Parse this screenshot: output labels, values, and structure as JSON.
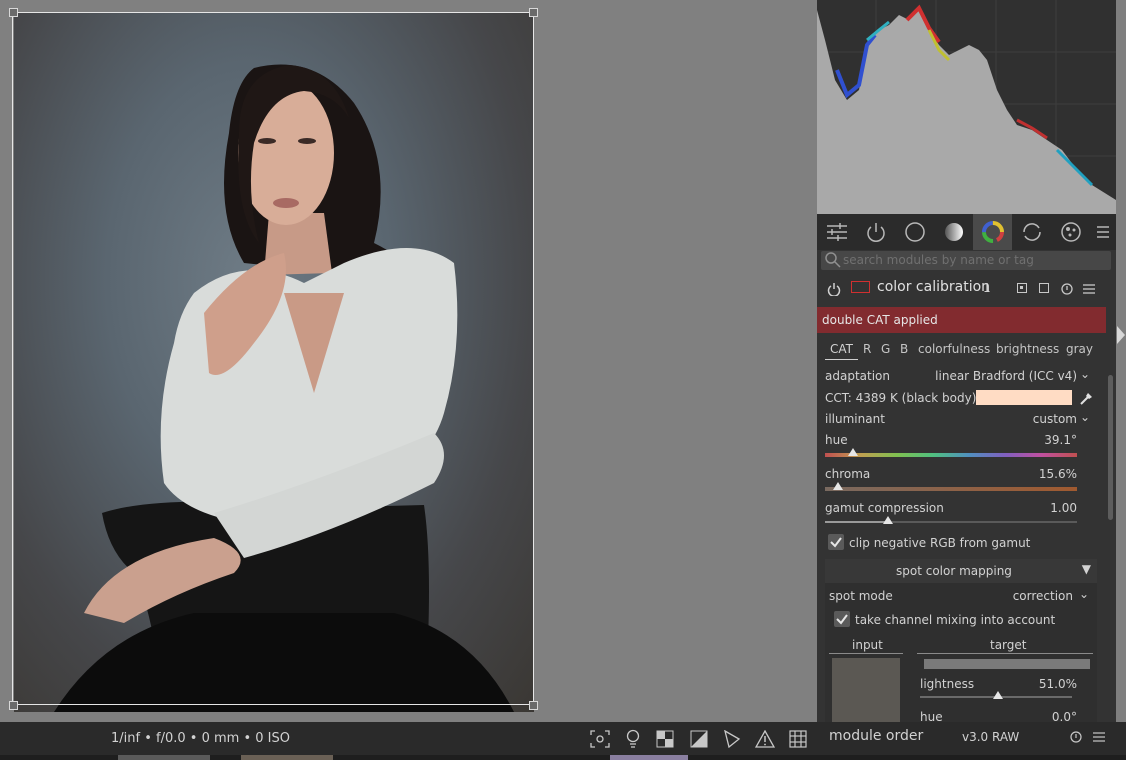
{
  "photo_info": "1/inf • f/0.0 • 0 mm • 0 ISO",
  "search": {
    "placeholder": "search modules by name or tag"
  },
  "module": {
    "name": "color calibration",
    "instance": "1",
    "warning": "double CAT applied",
    "tabs": [
      "CAT",
      "R",
      "G",
      "B",
      "colorfulness",
      "brightness",
      "gray"
    ],
    "active_tab": "CAT",
    "adaptation_label": "adaptation",
    "adaptation_value": "linear Bradford (ICC v4)",
    "cct_label": "CCT: 4389 K (black body)",
    "cct_swatch_color": "#ffdcc4",
    "illuminant_label": "illuminant",
    "illuminant_value": "custom",
    "hue_label": "hue",
    "hue_value": "39.1°",
    "hue_fraction": 0.11,
    "chroma_label": "chroma",
    "chroma_value": "15.6%",
    "chroma_fraction": 0.05,
    "gamut_label": "gamut compression",
    "gamut_value": "1.00",
    "gamut_fraction": 0.25,
    "clip_label": "clip negative RGB from gamut",
    "clip_checked": true,
    "spot_section": "spot color mapping",
    "spot_mode_label": "spot mode",
    "spot_mode_value": "correction",
    "channel_mixing_label": "take channel mixing into account",
    "channel_mixing_checked": true,
    "input_label": "input",
    "target_label": "target",
    "lightness_label": "lightness",
    "lightness_value": "51.0%",
    "lightness_fraction": 0.51,
    "hue2_label": "hue",
    "hue2_value": "0.0°",
    "input_swatch_color": "#5b5853"
  },
  "bottom": {
    "module_order_label": "module order",
    "module_order_value": "v3.0 RAW"
  },
  "colors": {
    "banner": "#822b2f",
    "panel": "#333333",
    "center_bg": "#808080"
  }
}
